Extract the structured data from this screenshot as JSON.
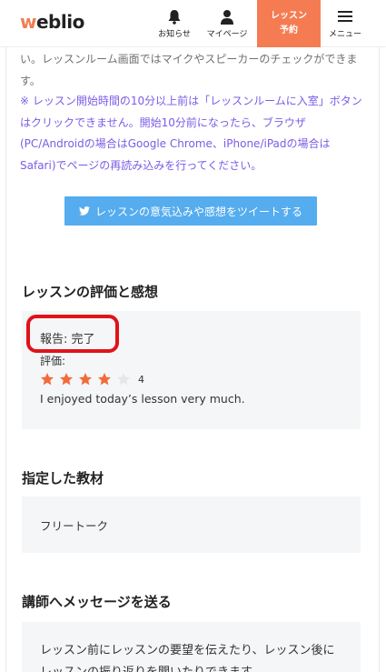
{
  "header": {
    "logo_w": "w",
    "logo_rest": "eblio",
    "notice_label": "お知らせ",
    "mypage_label": "マイページ",
    "reserve_line1": "レッスン",
    "reserve_line2": "予約",
    "menu_label": "メニュー",
    "accent_color": "#f57c52"
  },
  "notes": {
    "grey_text": "い。レッスンルーム画面ではマイクやスピーカーのチェックができます。",
    "purple_text": "※ レッスン開始時間の10分以上前は「レッスンルームに入室」ボタンはクリックできません。開始10分前になったら、ブラウザ(PC/Androidの場合はGoogle Chrome、iPhone/iPadの場合はSafari)でページの再読み込みを行ってください。",
    "purple_color": "#7b5ce6"
  },
  "tweet_button": {
    "label": "レッスンの意気込みや感想をツイートする",
    "color": "#55acee"
  },
  "evaluation": {
    "title": "レッスンの評価と感想",
    "report": "報告: 完了",
    "rating_label": "評価:",
    "rating": 4,
    "rating_max": 5,
    "rating_display": "4",
    "comment": "I enjoyed today’s lesson very much."
  },
  "material": {
    "title": "指定した教材",
    "value": "フリートーク"
  },
  "message": {
    "title": "講師へメッセージを送る",
    "description": "レッスン前にレッスンの要望を伝えたり、レッスン後にレッスンの振り返りを聞いたりできます。"
  }
}
